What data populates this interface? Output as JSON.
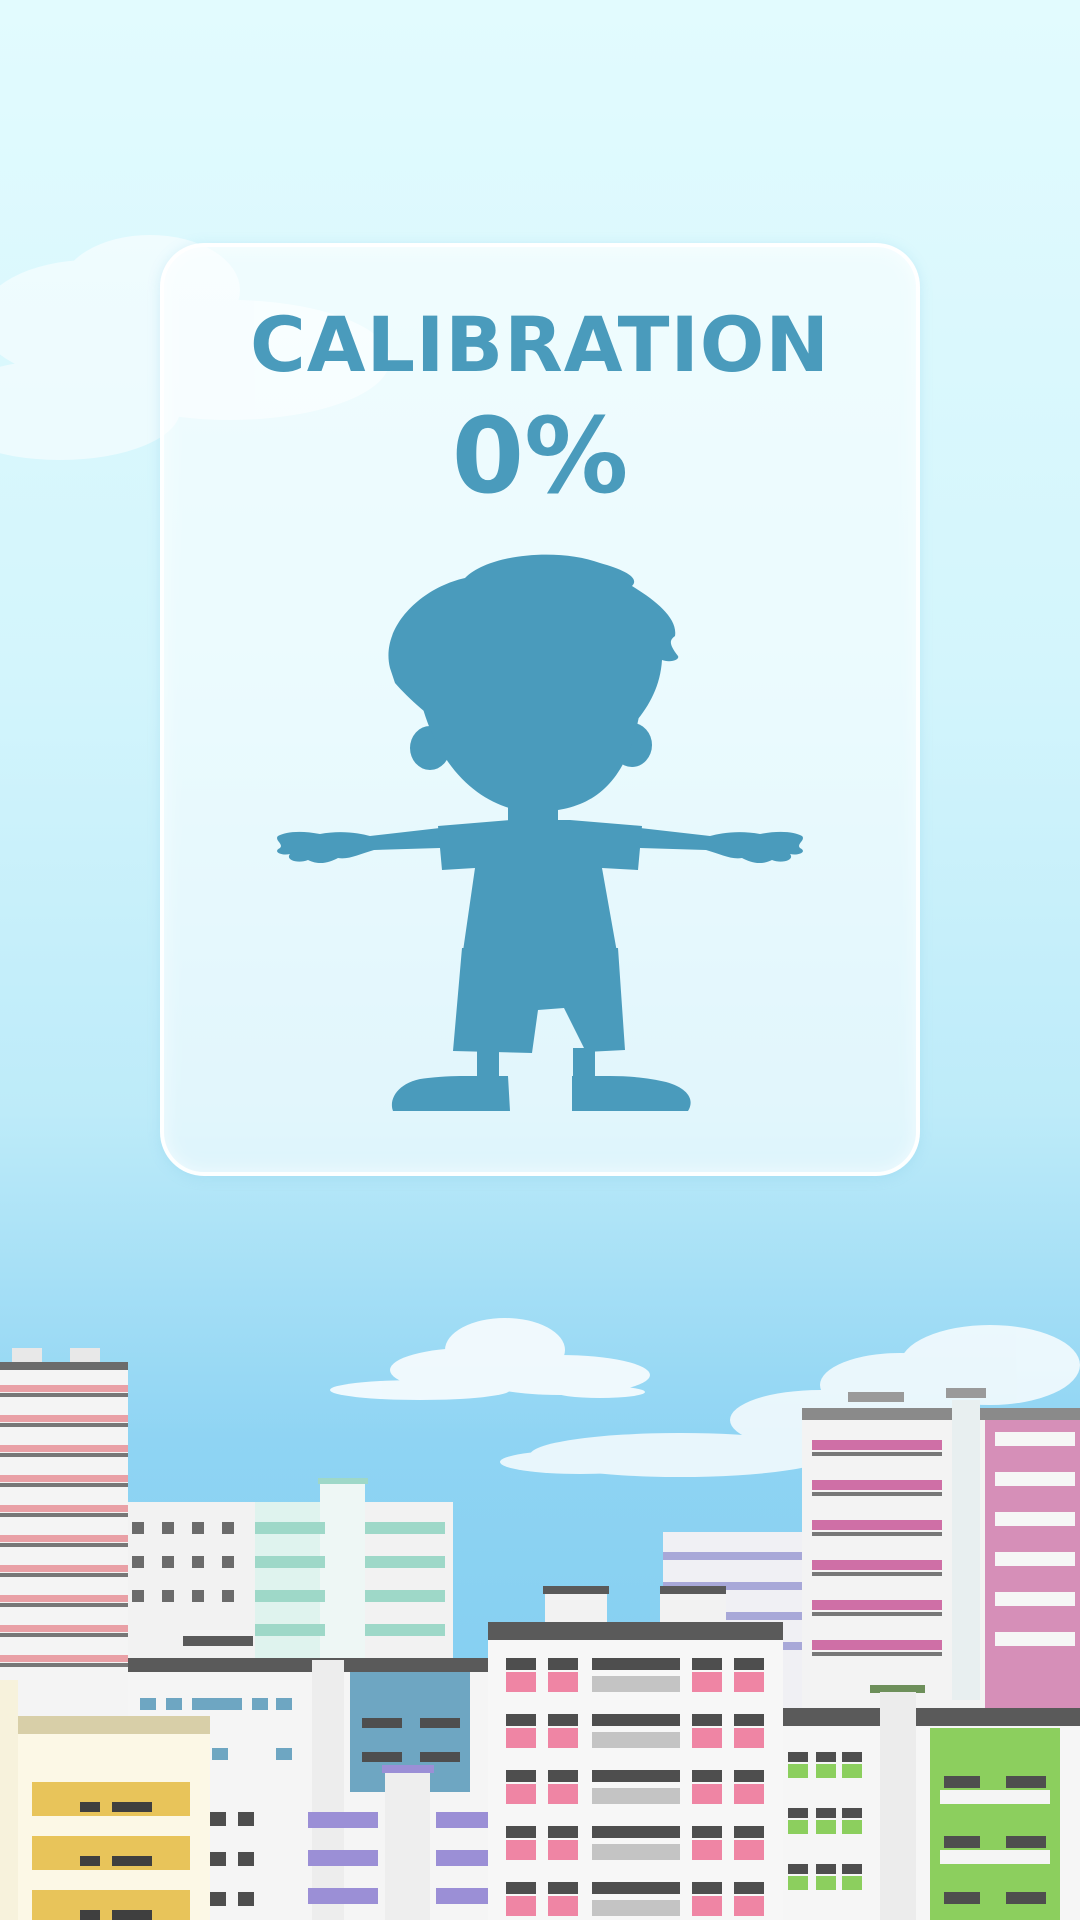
{
  "screen": {
    "title": "CALIBRATION",
    "progress_label": "0%",
    "progress": 0,
    "silhouette_icon": "child-t-pose-silhouette-icon"
  },
  "colors": {
    "accent": "#4a9bbc",
    "sky_top": "#e2fbfe",
    "sky_bottom": "#7ccbf0"
  }
}
